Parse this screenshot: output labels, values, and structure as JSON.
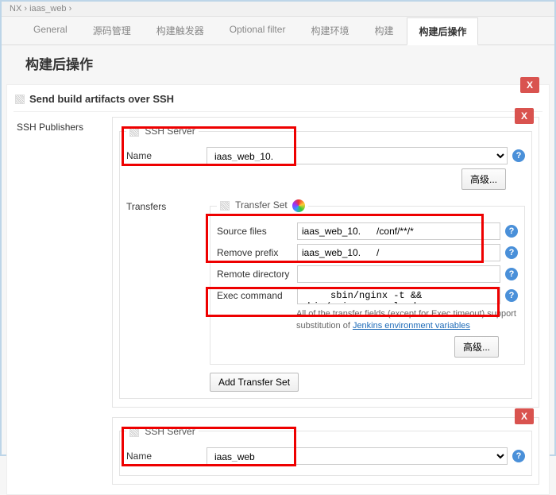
{
  "breadcrumb": {
    "a": "NX",
    "sep1": "›",
    "b": "iaas_web",
    "sep2": "›"
  },
  "tabs": [
    "General",
    "源码管理",
    "构建触发器",
    "Optional filter",
    "构建环境",
    "构建",
    "构建后操作"
  ],
  "active_tab": "构建后操作",
  "page_title": "构建后操作",
  "send_section": "Send build artifacts over SSH",
  "ssh_publishers": "SSH Publishers",
  "ssh_server_legend": "SSH Server",
  "name_label": "Name",
  "server1": {
    "name": "iaas_web_10."
  },
  "advanced_btn": "高级...",
  "transfers_label": "Transfers",
  "transfer_set_legend": "Transfer Set",
  "source_files_label": "Source files",
  "source_files_value": "iaas_web_10.      /conf/**/*",
  "remove_prefix_label": "Remove prefix",
  "remove_prefix_value": "iaas_web_10.      /",
  "remote_dir_label": "Remote directory",
  "remote_dir_value": "",
  "exec_cmd_label": "Exec command",
  "exec_cmd_value": "     sbin/nginx -t &&        sbin/nginx -s reload",
  "note_prefix": "All of the transfer fields (except for Exec timeout) support substitution of ",
  "note_link": "Jenkins environment variables",
  "add_transfer_btn": "Add Transfer Set",
  "server2": {
    "name": "iaas_web"
  }
}
